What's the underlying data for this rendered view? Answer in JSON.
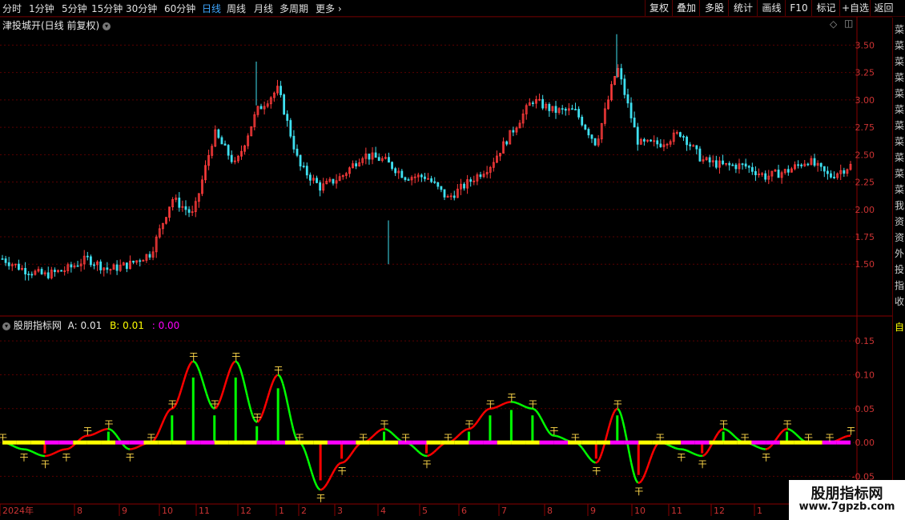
{
  "toolbar": {
    "periods": [
      "分时",
      "1分钟",
      "5分钟",
      "15分钟",
      "30分钟",
      "60分钟",
      "日线",
      "周线",
      "月线",
      "多周期",
      "更多"
    ],
    "active_period": "日线",
    "right_buttons": [
      "复权",
      "叠加",
      "多股",
      "统计",
      "画线",
      "F10",
      "标记",
      "+自选",
      "返回"
    ]
  },
  "main_panel": {
    "title": "津投城开(日线 前复权)",
    "collapse_icon": "chevron-down-circle-icon",
    "diamond_icon": "diamond-icon",
    "box_icon": "window-icon",
    "y_ticks": [
      "3.50",
      "3.25",
      "3.00",
      "2.75",
      "2.50",
      "2.25",
      "2.00",
      "1.75",
      "1.50"
    ],
    "y_tick_values": [
      3.5,
      3.25,
      3.0,
      2.75,
      2.5,
      2.25,
      2.0,
      1.75,
      1.5
    ]
  },
  "indicator_panel": {
    "name": "股朋指标网",
    "a_label": "A: 0.01",
    "b_label": "B: 0.01",
    "c_label": ": 0.00",
    "y_ticks": [
      "0.15",
      "0.10",
      "0.05",
      "0.00",
      "-0.05"
    ],
    "y_tick_values": [
      0.15,
      0.1,
      0.05,
      0.0,
      -0.05
    ],
    "signal_glyph": "干"
  },
  "x_axis": {
    "labels": [
      "2024年",
      "8",
      "9",
      "10",
      "11",
      "12",
      "1",
      "2",
      "3",
      "4",
      "5",
      "6",
      "7",
      "8",
      "9",
      "10",
      "11",
      "12",
      "1"
    ]
  },
  "right_strip": {
    "chars": [
      "菜",
      "菜",
      "菜",
      "菜",
      "菜",
      "菜",
      "菜",
      "菜",
      "菜",
      "菜",
      "菜",
      "我",
      "资",
      "资",
      "外",
      "投",
      "指",
      "收"
    ],
    "tail_char": "自"
  },
  "watermark": {
    "line1": "股朋指标网",
    "line2": "www.7gpzb.com"
  },
  "colors": {
    "up": "#ff3b3b",
    "down": "#3fe0f0",
    "ind_up": "#ff0000",
    "ind_down": "#00ff00",
    "yellow": "#ffff00",
    "magenta": "#ff00ff",
    "grid": "#5a0000"
  },
  "chart_data": [
    {
      "type": "candlestick",
      "title": "津投城开(日线 前复权)",
      "ylim": [
        1.1,
        3.7
      ],
      "x": [
        "2024年",
        "8",
        "9",
        "10",
        "11",
        "12",
        "1",
        "2",
        "3",
        "4",
        "5",
        "6",
        "7",
        "8",
        "9",
        "10",
        "11",
        "12",
        "1"
      ],
      "series": [
        {
          "name": "close",
          "approx_path": [
            1.55,
            1.45,
            1.4,
            1.45,
            1.55,
            1.45,
            1.5,
            1.6,
            2.1,
            1.95,
            2.7,
            2.4,
            2.9,
            3.1,
            2.4,
            2.2,
            2.3,
            2.5,
            2.45,
            2.3,
            2.3,
            2.1,
            2.25,
            2.4,
            2.7,
            3.0,
            2.9,
            2.9,
            2.6,
            3.3,
            2.6,
            2.6,
            2.7,
            2.45,
            2.4,
            2.4,
            2.3,
            2.35,
            2.45,
            2.3,
            2.4
          ]
        }
      ]
    },
    {
      "type": "line",
      "title": "股朋指标网",
      "ylim": [
        -0.09,
        0.18
      ],
      "series": [
        {
          "name": "A",
          "approx_path": [
            0.0,
            -0.01,
            -0.02,
            -0.01,
            0.01,
            0.02,
            -0.01,
            0.0,
            0.05,
            0.12,
            0.05,
            0.12,
            0.03,
            0.1,
            0.0,
            -0.07,
            -0.03,
            0.0,
            0.02,
            0.0,
            -0.02,
            0.0,
            0.02,
            0.05,
            0.06,
            0.05,
            0.01,
            0.0,
            -0.03,
            0.05,
            -0.06,
            0.0,
            -0.01,
            -0.02,
            0.02,
            0.0,
            -0.01,
            0.02,
            0.0,
            0.0,
            0.01
          ]
        },
        {
          "name": "B",
          "approx_path": [
            0.0,
            0.0,
            0.0,
            0.0,
            0.0,
            0.0,
            0.0,
            0.0,
            0.0,
            0.0,
            0.0,
            0.0,
            0.0,
            0.0,
            0.0,
            0.0,
            0.0,
            0.0,
            0.0,
            0.0,
            0.0,
            0.0,
            0.0,
            0.0,
            0.0,
            0.0,
            0.0,
            0.0,
            0.0,
            0.0,
            0.0,
            0.0,
            0.0,
            0.0,
            0.0,
            0.0,
            0.0,
            0.0,
            0.0,
            0.0,
            0.0
          ]
        }
      ]
    }
  ]
}
